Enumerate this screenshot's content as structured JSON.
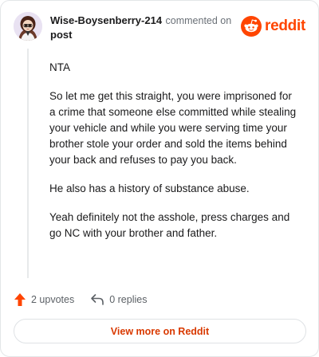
{
  "comment": {
    "author": "Wise-Boysenberry-214",
    "action_text": "commented on",
    "post_link_label": "post",
    "paragraphs": [
      "NTA",
      "So let me get this straight, you were imprisoned for a crime that someone else committed while stealing your vehicle and while you were serving time your brother stole your order and sold the items behind your back and refuses to pay you back.",
      "He also has a history of substance abuse.",
      "Yeah definitely not the asshole, press charges and go NC with your brother and father."
    ]
  },
  "brand": {
    "wordmark": "reddit",
    "icon": "reddit-snoo-icon",
    "color": "#ff4500"
  },
  "stats": {
    "upvotes": "2 upvotes",
    "upvote_icon": "upvote-arrow-icon",
    "upvote_color": "#ff4500",
    "replies": "0 replies",
    "reply_icon": "reply-arrow-icon"
  },
  "footer": {
    "view_more_label": "View more on Reddit",
    "link_color": "#d93900"
  }
}
